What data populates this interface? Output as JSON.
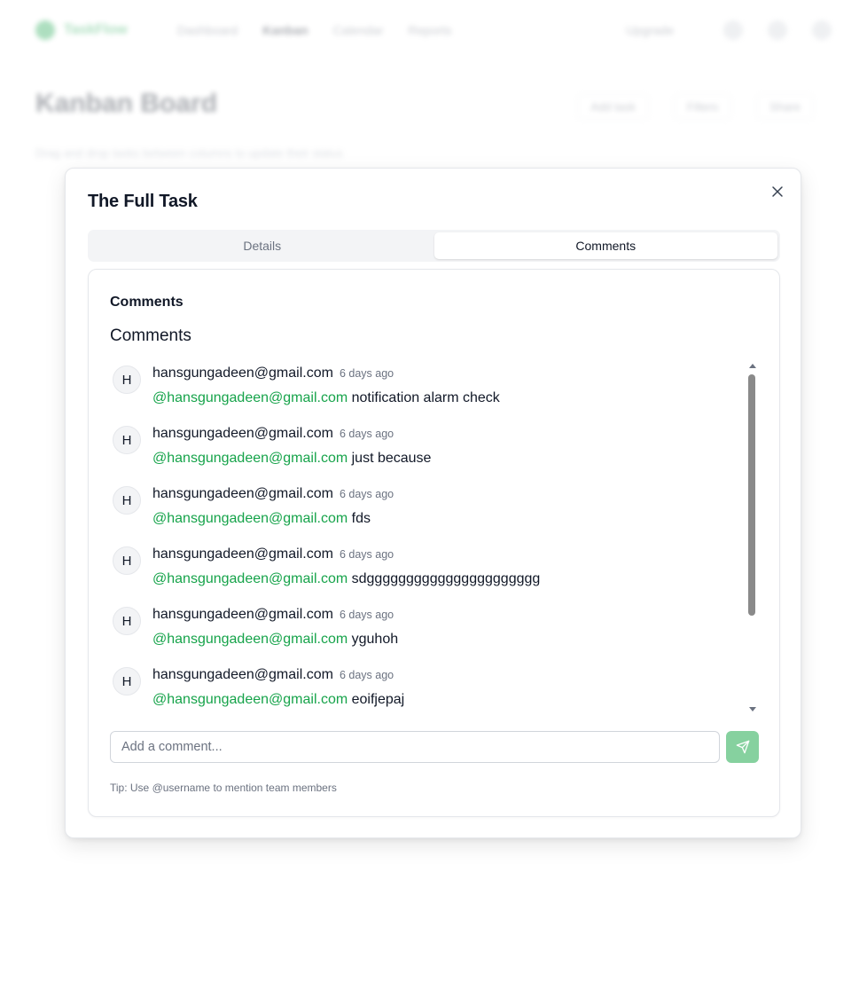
{
  "background": {
    "brand": "TaskFlow",
    "nav_items": [
      "Dashboard",
      "Kanban",
      "Calendar",
      "Reports"
    ],
    "nav_right_label": "Upgrade",
    "title": "Kanban Board",
    "actions": [
      "Add task",
      "Filters",
      "Share"
    ],
    "subtitle": "Drag and drop tasks between columns to update their status"
  },
  "modal": {
    "title": "The Full Task",
    "tabs": [
      {
        "label": "Details",
        "active": false
      },
      {
        "label": "Comments",
        "active": true
      }
    ],
    "card_header": "Comments",
    "section_title": "Comments",
    "comments": [
      {
        "avatar": "H",
        "author": "hansgungadeen@gmail.com",
        "time": "6 days ago",
        "mention": "@hansgungadeen@gmail.com",
        "text": " notification alarm check"
      },
      {
        "avatar": "H",
        "author": "hansgungadeen@gmail.com",
        "time": "6 days ago",
        "mention": "@hansgungadeen@gmail.com",
        "text": " just because"
      },
      {
        "avatar": "H",
        "author": "hansgungadeen@gmail.com",
        "time": "6 days ago",
        "mention": "@hansgungadeen@gmail.com",
        "text": " fds"
      },
      {
        "avatar": "H",
        "author": "hansgungadeen@gmail.com",
        "time": "6 days ago",
        "mention": "@hansgungadeen@gmail.com",
        "text": " sdgggggggggggggggggggggg"
      },
      {
        "avatar": "H",
        "author": "hansgungadeen@gmail.com",
        "time": "6 days ago",
        "mention": "@hansgungadeen@gmail.com",
        "text": " yguhoh"
      },
      {
        "avatar": "H",
        "author": "hansgungadeen@gmail.com",
        "time": "6 days ago",
        "mention": "@hansgungadeen@gmail.com",
        "text": " eoifjepaj"
      }
    ],
    "input": {
      "value": "",
      "placeholder": "Add a comment..."
    },
    "tip": "Tip: Use @username to mention team members",
    "icons": {
      "close": "close-icon",
      "send": "send-icon"
    },
    "colors": {
      "mention": "#16a34a",
      "send_button": "#86d19f",
      "scroll_thumb": "#8a8a8a"
    }
  }
}
